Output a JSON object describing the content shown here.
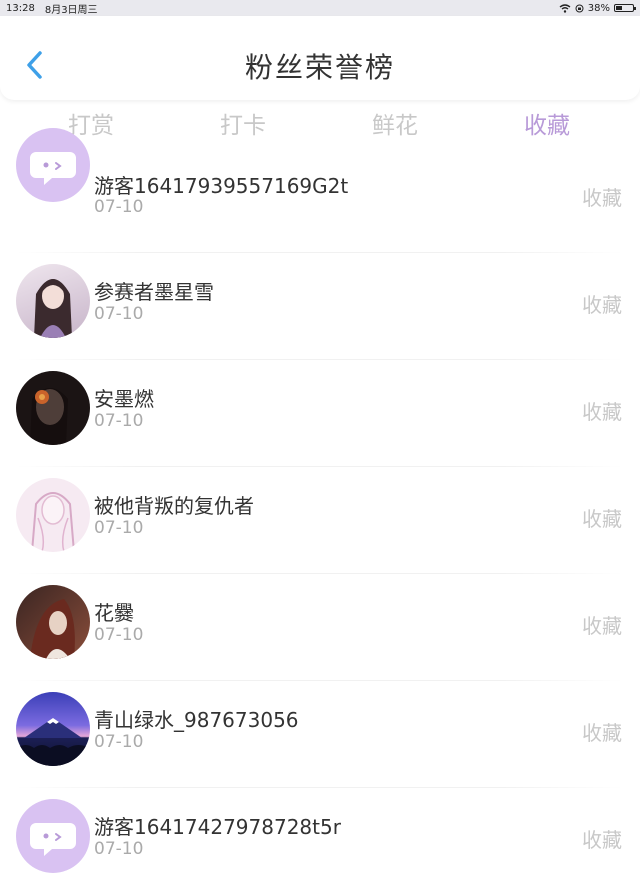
{
  "status_bar": {
    "time": "13:28",
    "date": "8月3日周三",
    "battery": "38%"
  },
  "header": {
    "title": "粉丝荣誉榜"
  },
  "tabs": [
    {
      "label": "打赏"
    },
    {
      "label": "打卡"
    },
    {
      "label": "鲜花"
    },
    {
      "label": "收藏"
    }
  ],
  "rows": [
    {
      "name": "游客16417939557169G2t",
      "date": "07-10",
      "action": "收藏",
      "avatar_icon": "chat-bubble-icon"
    },
    {
      "name": "参赛者墨星雪",
      "date": "07-10",
      "action": "收藏",
      "avatar_icon": "anime-girl-avatar"
    },
    {
      "name": "安墨燃",
      "date": "07-10",
      "action": "收藏",
      "avatar_icon": "dark-portrait-avatar"
    },
    {
      "name": "被他背叛的复仇者",
      "date": "07-10",
      "action": "收藏",
      "avatar_icon": "pink-sketch-avatar"
    },
    {
      "name": "花爨",
      "date": "07-10",
      "action": "收藏",
      "avatar_icon": "red-hair-avatar"
    },
    {
      "name": "青山绿水_987673056",
      "date": "07-10",
      "action": "收藏",
      "avatar_icon": "mountain-avatar"
    },
    {
      "name": "游客16417427978728t5r",
      "date": "07-10",
      "action": "收藏",
      "avatar_icon": "chat-bubble-icon"
    }
  ],
  "colors": {
    "accent": "#b89ad8",
    "back_arrow": "#3ea0e8",
    "muted": "#c8c8c8"
  }
}
